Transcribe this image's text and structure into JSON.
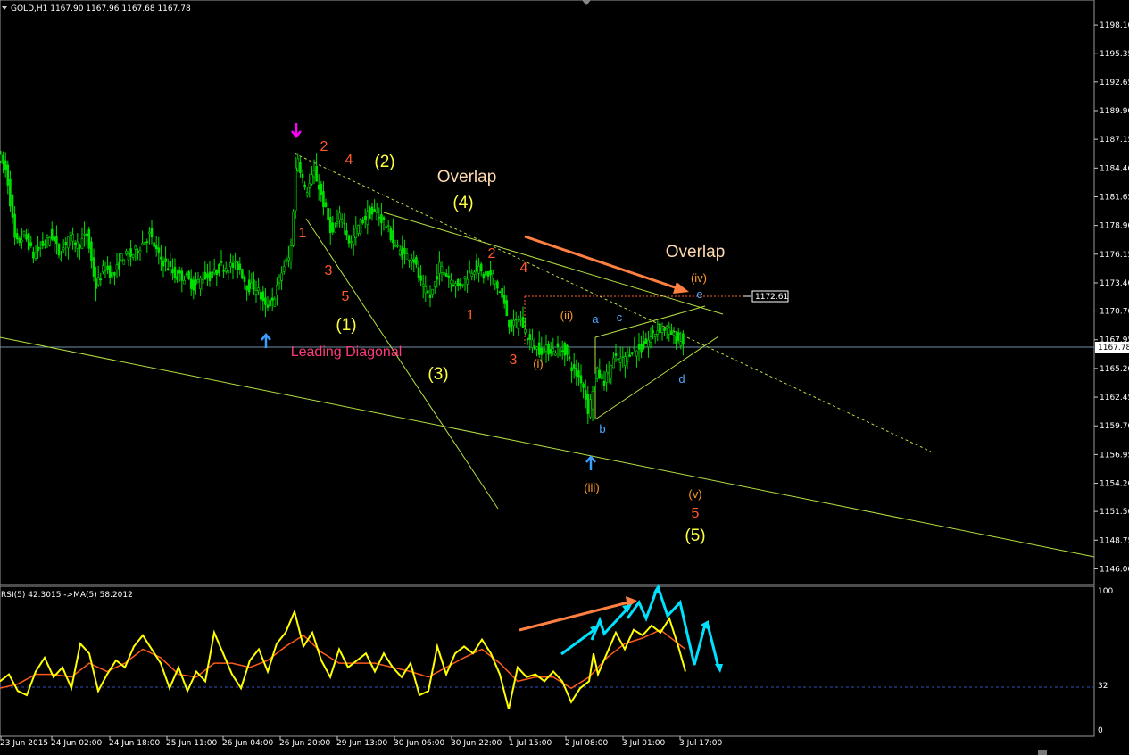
{
  "chart_data": {
    "type": "candlestick",
    "symbol_header": "GOLD,H1  1167.90 1167.96 1167.68 1167.78",
    "price_axis": {
      "ylim": [
        1144.5,
        1200.5
      ],
      "ticks": [
        "1198.10",
        "1195.35",
        "1192.65",
        "1189.90",
        "1187.15",
        "1184.40",
        "1181.65",
        "1178.90",
        "1176.15",
        "1173.40",
        "1170.70",
        "1167.95",
        "1165.20",
        "1162.45",
        "1159.70",
        "1156.95",
        "1154.20",
        "1151.50",
        "1148.75",
        "1146.00"
      ],
      "current_price": "1167.78",
      "level_price": "1172.61"
    },
    "time_axis": {
      "ticks": [
        "23 Jun 2015",
        "24 Jun 02:00",
        "24 Jun 18:00",
        "25 Jun 11:00",
        "26 Jun 04:00",
        "26 Jun 20:00",
        "29 Jun 13:00",
        "30 Jun 06:00",
        "30 Jun 22:00",
        "1 Jul 15:00",
        "2 Jul 08:00",
        "3 Jul 01:00",
        "3 Jul 17:00"
      ]
    },
    "price_path": [
      [
        0,
        1186
      ],
      [
        10,
        1184
      ],
      [
        20,
        1177
      ],
      [
        30,
        1178
      ],
      [
        40,
        1176
      ],
      [
        50,
        1177
      ],
      [
        60,
        1178
      ],
      [
        70,
        1176
      ],
      [
        80,
        1178
      ],
      [
        90,
        1177
      ],
      [
        100,
        1178
      ],
      [
        110,
        1173
      ],
      [
        120,
        1175
      ],
      [
        130,
        1174
      ],
      [
        140,
        1176
      ],
      [
        150,
        1176
      ],
      [
        160,
        1177
      ],
      [
        170,
        1178
      ],
      [
        180,
        1176
      ],
      [
        190,
        1175
      ],
      [
        200,
        1174
      ],
      [
        210,
        1174
      ],
      [
        220,
        1173
      ],
      [
        230,
        1174
      ],
      [
        240,
        1174
      ],
      [
        250,
        1175
      ],
      [
        260,
        1175
      ],
      [
        270,
        1175
      ],
      [
        280,
        1173
      ],
      [
        290,
        1173
      ],
      [
        300,
        1171
      ],
      [
        310,
        1172
      ],
      [
        320,
        1175
      ],
      [
        328,
        1176
      ],
      [
        335,
        1186
      ],
      [
        345,
        1182
      ],
      [
        355,
        1184
      ],
      [
        365,
        1181
      ],
      [
        375,
        1178
      ],
      [
        385,
        1180
      ],
      [
        395,
        1177
      ],
      [
        405,
        1179
      ],
      [
        415,
        1180
      ],
      [
        425,
        1180
      ],
      [
        435,
        1179
      ],
      [
        445,
        1177
      ],
      [
        455,
        1176
      ],
      [
        465,
        1176
      ],
      [
        475,
        1173
      ],
      [
        485,
        1172
      ],
      [
        495,
        1175
      ],
      [
        505,
        1174
      ],
      [
        515,
        1173
      ],
      [
        525,
        1174
      ],
      [
        535,
        1175
      ],
      [
        545,
        1174
      ],
      [
        555,
        1174
      ],
      [
        565,
        1172
      ],
      [
        575,
        1169
      ],
      [
        585,
        1170
      ],
      [
        595,
        1168
      ],
      [
        605,
        1167
      ],
      [
        615,
        1167
      ],
      [
        625,
        1167
      ],
      [
        635,
        1167
      ],
      [
        645,
        1165
      ],
      [
        655,
        1164
      ],
      [
        662,
        1161
      ],
      [
        670,
        1165
      ],
      [
        680,
        1164
      ],
      [
        690,
        1166
      ],
      [
        700,
        1166
      ],
      [
        710,
        1167
      ],
      [
        720,
        1167
      ],
      [
        730,
        1168
      ],
      [
        740,
        1169
      ],
      [
        750,
        1169
      ],
      [
        760,
        1168
      ],
      [
        768,
        1167.8
      ]
    ],
    "rsi": {
      "label": "RSI(5) 42.3015  ->MA(5) 58.2012",
      "ylim": [
        0,
        100
      ],
      "ticks": [
        "100",
        "32",
        "0"
      ],
      "level": 32,
      "values": [
        [
          0,
          35
        ],
        [
          10,
          40
        ],
        [
          20,
          28
        ],
        [
          30,
          25
        ],
        [
          40,
          42
        ],
        [
          50,
          52
        ],
        [
          60,
          38
        ],
        [
          70,
          45
        ],
        [
          80,
          30
        ],
        [
          90,
          62
        ],
        [
          100,
          55
        ],
        [
          110,
          28
        ],
        [
          120,
          40
        ],
        [
          130,
          50
        ],
        [
          140,
          45
        ],
        [
          150,
          60
        ],
        [
          160,
          68
        ],
        [
          170,
          58
        ],
        [
          180,
          48
        ],
        [
          190,
          30
        ],
        [
          200,
          45
        ],
        [
          210,
          28
        ],
        [
          220,
          42
        ],
        [
          230,
          35
        ],
        [
          240,
          70
        ],
        [
          250,
          55
        ],
        [
          260,
          40
        ],
        [
          270,
          30
        ],
        [
          280,
          50
        ],
        [
          290,
          58
        ],
        [
          300,
          42
        ],
        [
          310,
          62
        ],
        [
          320,
          70
        ],
        [
          330,
          85
        ],
        [
          340,
          60
        ],
        [
          350,
          70
        ],
        [
          360,
          50
        ],
        [
          370,
          38
        ],
        [
          380,
          58
        ],
        [
          390,
          45
        ],
        [
          400,
          50
        ],
        [
          410,
          55
        ],
        [
          420,
          42
        ],
        [
          430,
          55
        ],
        [
          440,
          45
        ],
        [
          450,
          38
        ],
        [
          460,
          48
        ],
        [
          470,
          25
        ],
        [
          480,
          28
        ],
        [
          490,
          60
        ],
        [
          500,
          40
        ],
        [
          510,
          55
        ],
        [
          520,
          60
        ],
        [
          530,
          55
        ],
        [
          540,
          65
        ],
        [
          550,
          55
        ],
        [
          560,
          40
        ],
        [
          570,
          15
        ],
        [
          580,
          45
        ],
        [
          590,
          38
        ],
        [
          600,
          40
        ],
        [
          610,
          35
        ],
        [
          620,
          42
        ],
        [
          630,
          35
        ],
        [
          640,
          20
        ],
        [
          650,
          30
        ],
        [
          660,
          35
        ],
        [
          665,
          55
        ],
        [
          670,
          40
        ],
        [
          680,
          55
        ],
        [
          690,
          70
        ],
        [
          700,
          58
        ],
        [
          710,
          72
        ],
        [
          720,
          68
        ],
        [
          730,
          75
        ],
        [
          740,
          70
        ],
        [
          750,
          80
        ],
        [
          760,
          60
        ],
        [
          768,
          42
        ]
      ],
      "ma_values": [
        [
          0,
          30
        ],
        [
          20,
          33
        ],
        [
          40,
          40
        ],
        [
          60,
          40
        ],
        [
          80,
          38
        ],
        [
          100,
          48
        ],
        [
          120,
          42
        ],
        [
          140,
          48
        ],
        [
          160,
          58
        ],
        [
          180,
          52
        ],
        [
          200,
          40
        ],
        [
          220,
          38
        ],
        [
          240,
          48
        ],
        [
          260,
          48
        ],
        [
          280,
          45
        ],
        [
          300,
          50
        ],
        [
          320,
          60
        ],
        [
          340,
          68
        ],
        [
          360,
          56
        ],
        [
          380,
          48
        ],
        [
          400,
          48
        ],
        [
          420,
          48
        ],
        [
          440,
          45
        ],
        [
          460,
          42
        ],
        [
          480,
          38
        ],
        [
          500,
          45
        ],
        [
          520,
          52
        ],
        [
          540,
          58
        ],
        [
          560,
          48
        ],
        [
          580,
          35
        ],
        [
          600,
          38
        ],
        [
          620,
          38
        ],
        [
          640,
          30
        ],
        [
          660,
          38
        ],
        [
          680,
          52
        ],
        [
          700,
          62
        ],
        [
          720,
          66
        ],
        [
          740,
          72
        ],
        [
          760,
          62
        ],
        [
          768,
          58
        ]
      ]
    },
    "wave_labels": [
      {
        "text": "2",
        "x": 363,
        "y": 169,
        "color": "#ff5a28",
        "size": 16
      },
      {
        "text": "4",
        "x": 391,
        "y": 184,
        "color": "#ff5a28",
        "size": 16
      },
      {
        "text": "(2)",
        "x": 431,
        "y": 187,
        "color": "#ffff40",
        "size": 19
      },
      {
        "text": "Overlap",
        "x": 523,
        "y": 204,
        "color": "#ffd9b0",
        "size": 19
      },
      {
        "text": "(4)",
        "x": 519,
        "y": 233,
        "color": "#ffff40",
        "size": 19
      },
      {
        "text": "1",
        "x": 339,
        "y": 266,
        "color": "#ff5a28",
        "size": 16
      },
      {
        "text": "3",
        "x": 368,
        "y": 308,
        "color": "#ff5a28",
        "size": 16
      },
      {
        "text": "5",
        "x": 387,
        "y": 337,
        "color": "#ff5a28",
        "size": 16
      },
      {
        "text": "(1)",
        "x": 388,
        "y": 370,
        "color": "#ffff40",
        "size": 19
      },
      {
        "text": "Leading Diagonal",
        "x": 388,
        "y": 399,
        "color": "#ff3a7a",
        "size": 16
      },
      {
        "text": "(3)",
        "x": 491,
        "y": 425,
        "color": "#ffff40",
        "size": 19
      },
      {
        "text": "2",
        "x": 551,
        "y": 289,
        "color": "#ff5a28",
        "size": 16
      },
      {
        "text": "4",
        "x": 587,
        "y": 305,
        "color": "#ff5a28",
        "size": 16
      },
      {
        "text": "1",
        "x": 527,
        "y": 358,
        "color": "#ff5a28",
        "size": 16
      },
      {
        "text": "3",
        "x": 575,
        "y": 408,
        "color": "#ff5a28",
        "size": 16
      },
      {
        "text": "(ii)",
        "x": 635,
        "y": 358,
        "color": "#ff9a2a",
        "size": 13
      },
      {
        "text": "(i)",
        "x": 603,
        "y": 412,
        "color": "#ff9a2a",
        "size": 13
      },
      {
        "text": "a",
        "x": 667,
        "y": 362,
        "color": "#4aa8ff",
        "size": 13
      },
      {
        "text": "c",
        "x": 694,
        "y": 360,
        "color": "#4aa8ff",
        "size": 13
      },
      {
        "text": "d",
        "x": 764,
        "y": 429,
        "color": "#4aa8ff",
        "size": 13
      },
      {
        "text": "b",
        "x": 675,
        "y": 485,
        "color": "#4aa8ff",
        "size": 13
      },
      {
        "text": "(iii)",
        "x": 663,
        "y": 551,
        "color": "#ff9a2a",
        "size": 13
      },
      {
        "text": "Overlap",
        "x": 779,
        "y": 288,
        "color": "#ffd9b0",
        "size": 19
      },
      {
        "text": "(iv)",
        "x": 783,
        "y": 316,
        "color": "#ff9a2a",
        "size": 13
      },
      {
        "text": "e",
        "x": 784,
        "y": 334,
        "color": "#4aa8ff",
        "size": 13
      },
      {
        "text": "(v)",
        "x": 779,
        "y": 558,
        "color": "#ff9a2a",
        "size": 13
      },
      {
        "text": "5",
        "x": 779,
        "y": 580,
        "color": "#ff5a28",
        "size": 16
      },
      {
        "text": "(5)",
        "x": 779,
        "y": 606,
        "color": "#ffff40",
        "size": 19
      }
    ],
    "colors": {
      "candle": "#00e000",
      "trendline": "#b4e040",
      "rsi": "#ffff00",
      "rsi_ma": "#ff5a1a",
      "arrow_orange": "#ff8040",
      "arrow_cyan": "#00e0ff",
      "marker_down": "#ff00ff",
      "marker_up": "#3aa0ff"
    }
  }
}
